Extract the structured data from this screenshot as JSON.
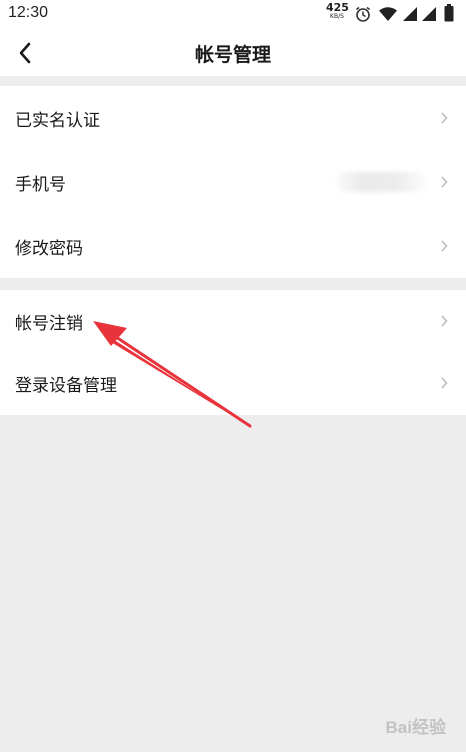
{
  "status_bar": {
    "time": "12:30",
    "network_speed": "425",
    "network_speed_unit": "KB/S",
    "icons": [
      "alarm-icon",
      "wifi-icon",
      "signal-icon",
      "signal-icon",
      "battery-icon"
    ]
  },
  "header": {
    "back_icon": "back-arrow-icon",
    "title": "帐号管理"
  },
  "menu_groups": [
    {
      "items": [
        {
          "label": "已实名认证",
          "icon": "chevron-right-icon"
        },
        {
          "label": "手机号",
          "value": "",
          "icon": "chevron-right-icon"
        },
        {
          "label": "修改密码",
          "icon": "chevron-right-icon"
        }
      ]
    },
    {
      "items": [
        {
          "label": "帐号注销",
          "icon": "chevron-right-icon"
        },
        {
          "label": "登录设备管理",
          "icon": "chevron-right-icon"
        }
      ]
    }
  ],
  "annotation": {
    "type": "arrow",
    "points_to": "帐号注销",
    "color": "#e8333a"
  },
  "watermark": {
    "text": "Bai经验"
  },
  "colors": {
    "background": "#ededed",
    "surface": "#ffffff",
    "chevron": "#bbbbbb",
    "annotation": "#e8333a"
  }
}
